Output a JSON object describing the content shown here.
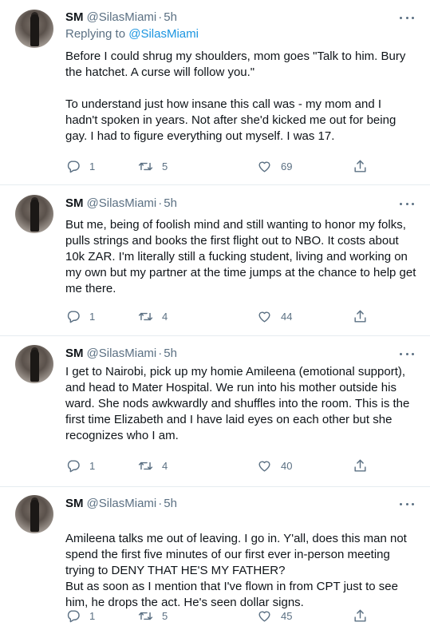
{
  "tweets": [
    {
      "name": "SM",
      "handle": "@SilasMiami",
      "time": "5h",
      "replying_prefix": "Replying to",
      "replying_to": "@SilasMiami",
      "paragraphs": [
        "Before I could shrug my shoulders, mom goes \"Talk to him. Bury the hatchet. A curse will follow you.\"",
        "To understand just how insane this call was - my mom and I hadn't spoken in years. Not after she'd kicked me out for being gay. I had to figure everything out myself. I was 17."
      ],
      "replies": "1",
      "retweets": "5",
      "likes": "69"
    },
    {
      "name": "SM",
      "handle": "@SilasMiami",
      "time": "5h",
      "paragraphs": [
        "But me, being of foolish mind and still wanting to honor my folks, pulls strings and books the first flight out to NBO. It costs about 10k ZAR. I'm literally still a fucking student, living and working on my own but my partner at the time jumps at the chance to help get me there."
      ],
      "replies": "1",
      "retweets": "4",
      "likes": "44"
    },
    {
      "name": "SM",
      "handle": "@SilasMiami",
      "time": "5h",
      "paragraphs": [
        "I get to Nairobi, pick up my homie Amileena (emotional support), and head to Mater Hospital. We run into his mother outside his ward. She nods awkwardly and shuffles into the room. This is the first time Elizabeth and I have laid eyes on each other but she recognizes who I am."
      ],
      "replies": "1",
      "retweets": "4",
      "likes": "40"
    },
    {
      "name": "SM",
      "handle": "@SilasMiami",
      "time": "5h",
      "paragraphs": [
        "Amileena talks me out of leaving. I go in. Y'all, does this man not spend the first five minutes of our first ever in-person meeting trying to DENY THAT HE'S MY FATHER?\nBut as soon as I mention that I've flown in from CPT just to see him, he drops the act. He's seen dollar signs."
      ],
      "replies": "1",
      "retweets": "5",
      "likes": "45"
    }
  ],
  "separator": "·",
  "colors": {
    "text": "#0f1419",
    "secondary": "#5b7083",
    "link": "#1b95e0",
    "divider": "#e6ecf0"
  },
  "icons": {
    "reply": "reply-icon",
    "retweet": "retweet-icon",
    "like": "heart-icon",
    "share": "share-icon",
    "more": "more-options-icon"
  }
}
